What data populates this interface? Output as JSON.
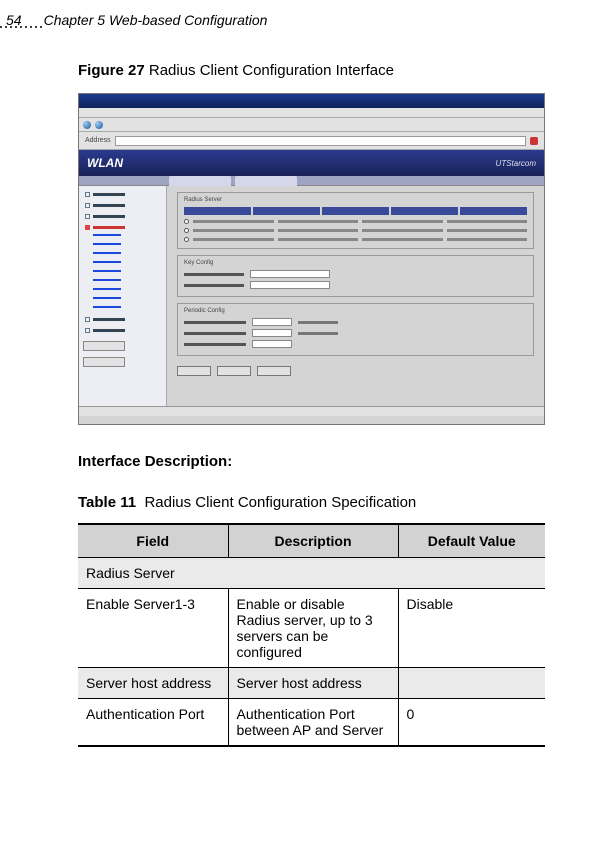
{
  "page": {
    "number": "54",
    "chapter": "Chapter 5 Web-based Configuration"
  },
  "figure": {
    "label": "Figure 27",
    "title": "Radius Client Configuration Interface"
  },
  "screenshot": {
    "brand": "WLAN",
    "brand_right": "UTStarcom",
    "panel_radius": "Radius Server",
    "panel_key": "Key Config",
    "panel_periodic": "Periodic Config"
  },
  "section_heading": "Interface Description:",
  "table": {
    "label": "Table 11",
    "title": "Radius Client Configuration Specification",
    "headers": {
      "field": "Field",
      "desc": "Description",
      "default": "Default Value"
    },
    "rows": [
      {
        "type": "section",
        "field": "Radius Server"
      },
      {
        "type": "data",
        "field": "Enable Server1-3",
        "desc": "Enable or disable Radius server, up to 3 servers can be configured",
        "default": "Disable"
      },
      {
        "type": "data_alt",
        "field": "Server host address",
        "desc": "Server host address",
        "default": ""
      },
      {
        "type": "data",
        "field": "Authentication Port",
        "desc": "Authentication Port between AP and Server",
        "default": "0"
      }
    ]
  }
}
